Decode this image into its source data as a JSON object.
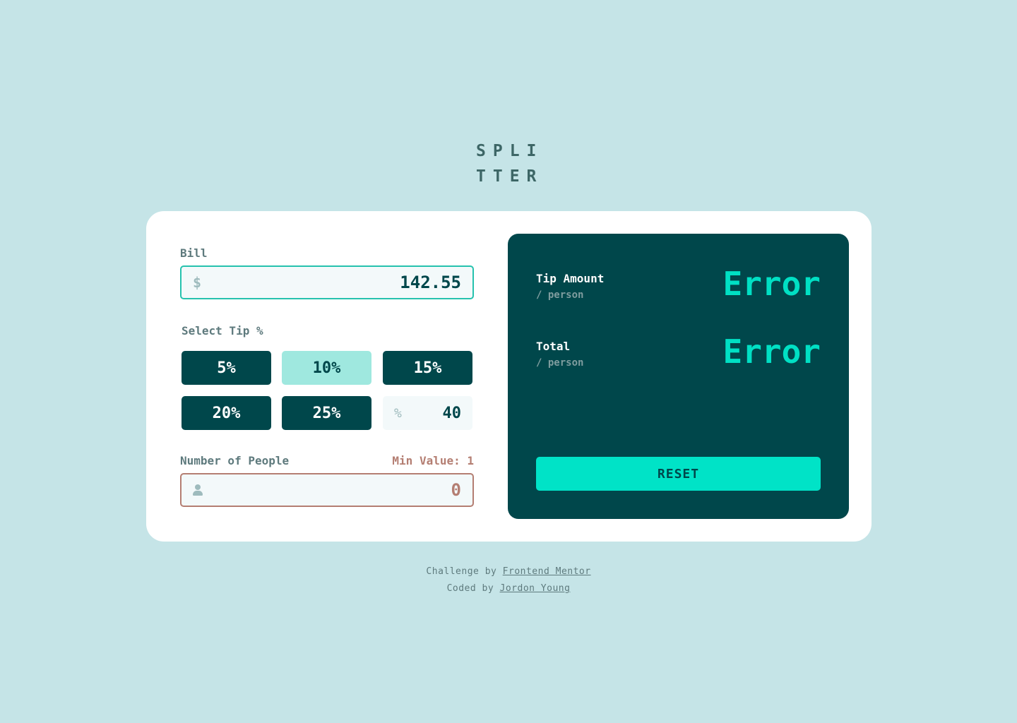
{
  "logo": {
    "line1": "SPLI",
    "line2": "TTER"
  },
  "bill": {
    "label": "Bill",
    "prefix": "$",
    "value": "142.55"
  },
  "tip": {
    "label": "Select Tip %",
    "options": [
      "5%",
      "10%",
      "15%",
      "20%",
      "25%"
    ],
    "selected": "10%",
    "custom_symbol": "%",
    "custom_value": "40"
  },
  "people": {
    "label": "Number of People",
    "error": "Min Value: 1",
    "value": "0"
  },
  "results": {
    "tip_amount": {
      "title": "Tip Amount",
      "sub": "/ person",
      "value": "Error"
    },
    "total": {
      "title": "Total",
      "sub": "/ person",
      "value": "Error"
    },
    "reset_label": "RESET"
  },
  "attribution": {
    "challenge_prefix": "Challenge by",
    "challenge_link": "Frontend Mentor",
    "coded_prefix": "Coded by",
    "coded_link": "Jordon Young"
  },
  "colors": {
    "background": "#c5e4e7",
    "dark": "#00474b",
    "accent": "#00e3c7",
    "error": "#b47e72"
  }
}
